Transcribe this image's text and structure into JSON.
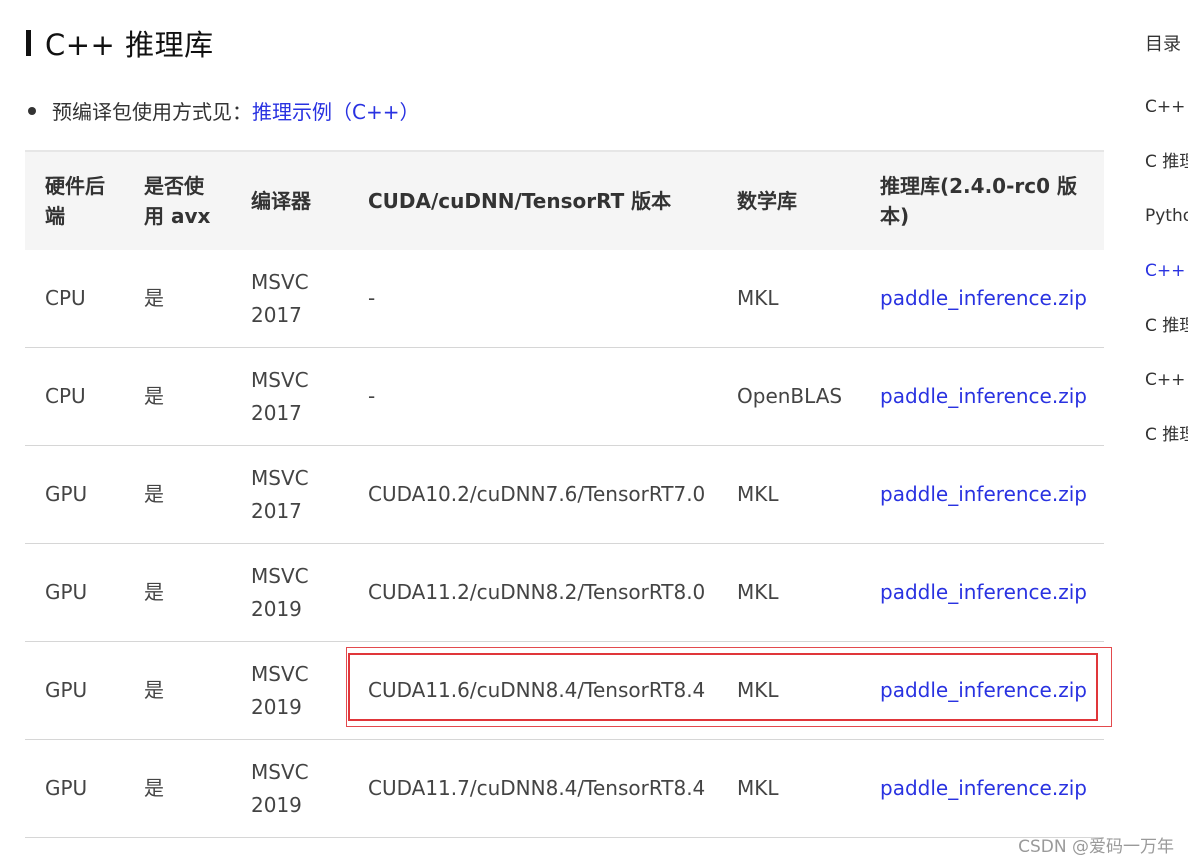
{
  "heading": "C++ 推理库",
  "bullet": {
    "text": "预编译包使用方式见：",
    "link": "推理示例（C++）"
  },
  "table": {
    "headers": [
      "硬件后端",
      "是否使用 avx",
      "编译器",
      "CUDA/cuDNN/TensorRT 版本",
      "数学库",
      "推理库(2.4.0-rc0 版本)"
    ],
    "rows": [
      [
        "CPU",
        "是",
        "MSVC 2017",
        "-",
        "MKL",
        "paddle_inference.zip"
      ],
      [
        "CPU",
        "是",
        "MSVC 2017",
        "-",
        "OpenBLAS",
        "paddle_inference.zip"
      ],
      [
        "GPU",
        "是",
        "MSVC 2017",
        "CUDA10.2/cuDNN7.6/TensorRT7.0",
        "MKL",
        "paddle_inference.zip"
      ],
      [
        "GPU",
        "是",
        "MSVC 2019",
        "CUDA11.2/cuDNN8.2/TensorRT8.0",
        "MKL",
        "paddle_inference.zip"
      ],
      [
        "GPU",
        "是",
        "MSVC 2019",
        "CUDA11.6/cuDNN8.4/TensorRT8.4",
        "MKL",
        "paddle_inference.zip"
      ],
      [
        "GPU",
        "是",
        "MSVC 2019",
        "CUDA11.7/cuDNN8.4/TensorRT8.4",
        "MKL",
        "paddle_inference.zip"
      ]
    ]
  },
  "toc": {
    "title": "目录",
    "items": [
      {
        "label": "C++ 推理库",
        "active": false
      },
      {
        "label": "C 推理库",
        "active": false
      },
      {
        "label": "Python 推理库",
        "active": false
      },
      {
        "label": "C++ 推理库",
        "active": true
      },
      {
        "label": "C 推理库",
        "active": false
      },
      {
        "label": "C++ 推理库",
        "active": false
      },
      {
        "label": "C 推理库",
        "active": false
      }
    ]
  },
  "colors": {
    "link": "#2932e1",
    "highlight": "#e0363a",
    "header_bg": "#f5f5f5"
  },
  "watermark": "CSDN @爱码一万年"
}
